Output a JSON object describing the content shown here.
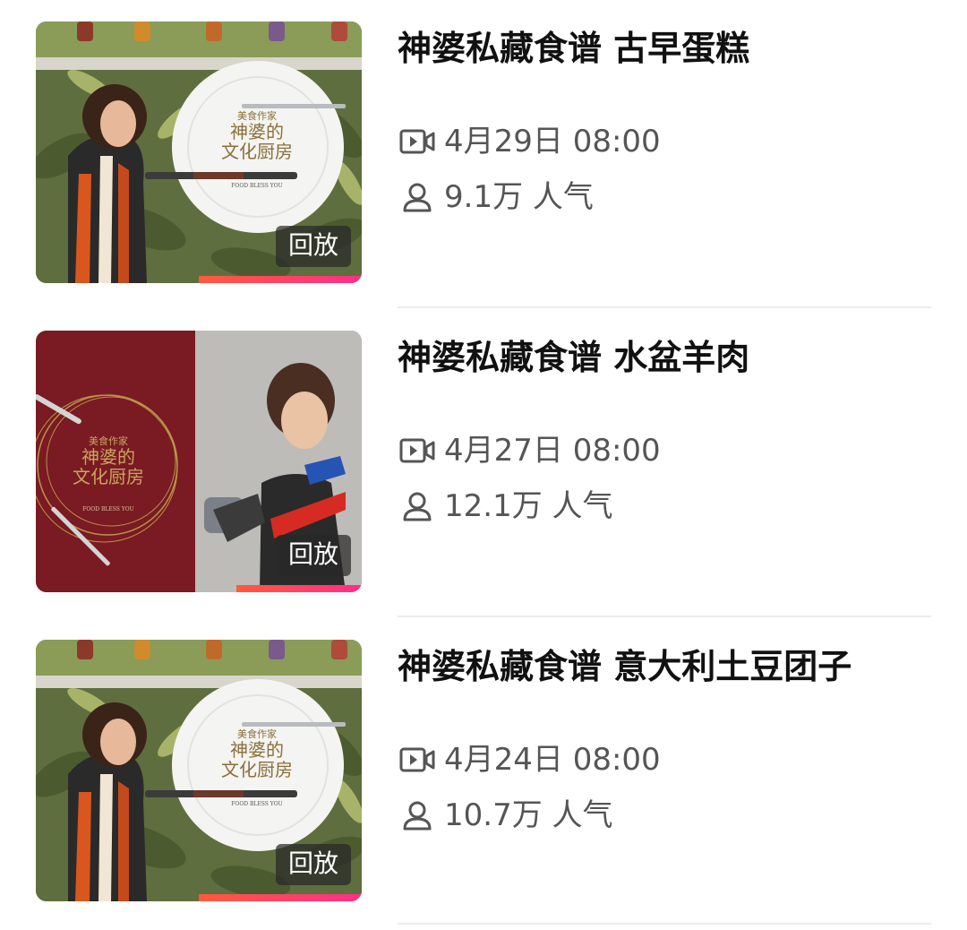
{
  "items": [
    {
      "title": "神婆私藏食谱 古早蛋糕",
      "date_time": "4月29日 08:00",
      "popularity": "9.1万 人气",
      "badge": "回放",
      "thumb_style": "kitchen"
    },
    {
      "title": "神婆私藏食谱 水盆羊肉",
      "date_time": "4月27日 08:00",
      "popularity": "12.1万 人气",
      "badge": "回放",
      "thumb_style": "split"
    },
    {
      "title": "神婆私藏食谱 意大利土豆团子",
      "date_time": "4月24日 08:00",
      "popularity": "10.7万 人气",
      "badge": "回放",
      "thumb_style": "kitchen"
    }
  ],
  "thumb_text": {
    "tag": "美食作家",
    "name_line1": "神婆的",
    "name_line2": "文化厨房",
    "slogan": "FOOD BLESS YOU"
  },
  "icons": {
    "time": "video-camera-icon",
    "popularity": "user-icon"
  },
  "colors": {
    "accent_gradient_start": "#ff5a3c",
    "accent_gradient_end": "#ff2e8a",
    "title": "#111111",
    "meta": "#555555",
    "divider": "#ececec",
    "maroon": "#7a1a22"
  }
}
